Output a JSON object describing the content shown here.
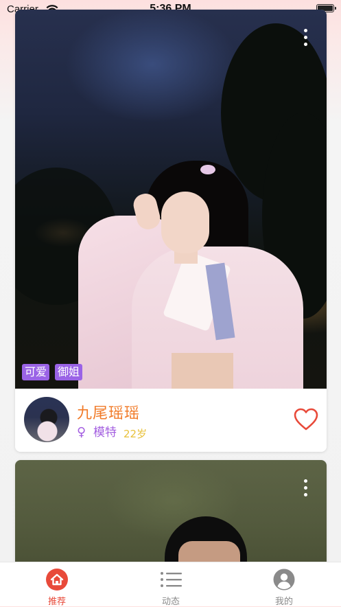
{
  "status_bar": {
    "carrier": "Carrier",
    "time": "5:36 PM"
  },
  "cards": [
    {
      "tags": [
        "可爱",
        "御姐"
      ],
      "nickname": "九尾瑶瑶",
      "gender_symbol": "♀",
      "profession": "模特",
      "age": "22岁",
      "like_icon": "heart-outline-icon",
      "more_icon": "more-vertical-icon"
    },
    {
      "more_icon": "more-vertical-icon"
    }
  ],
  "tab_bar": {
    "tabs": [
      {
        "label": "推荐",
        "icon": "home-icon",
        "active": true
      },
      {
        "label": "动态",
        "icon": "list-icon",
        "active": false
      },
      {
        "label": "我的",
        "icon": "user-icon",
        "active": false
      }
    ]
  },
  "colors": {
    "accent": "#e84a3a",
    "tag_bg": "#9a63e6",
    "nickname": "#f17a27",
    "profession": "#a35ee0",
    "age": "#e8c13a"
  }
}
